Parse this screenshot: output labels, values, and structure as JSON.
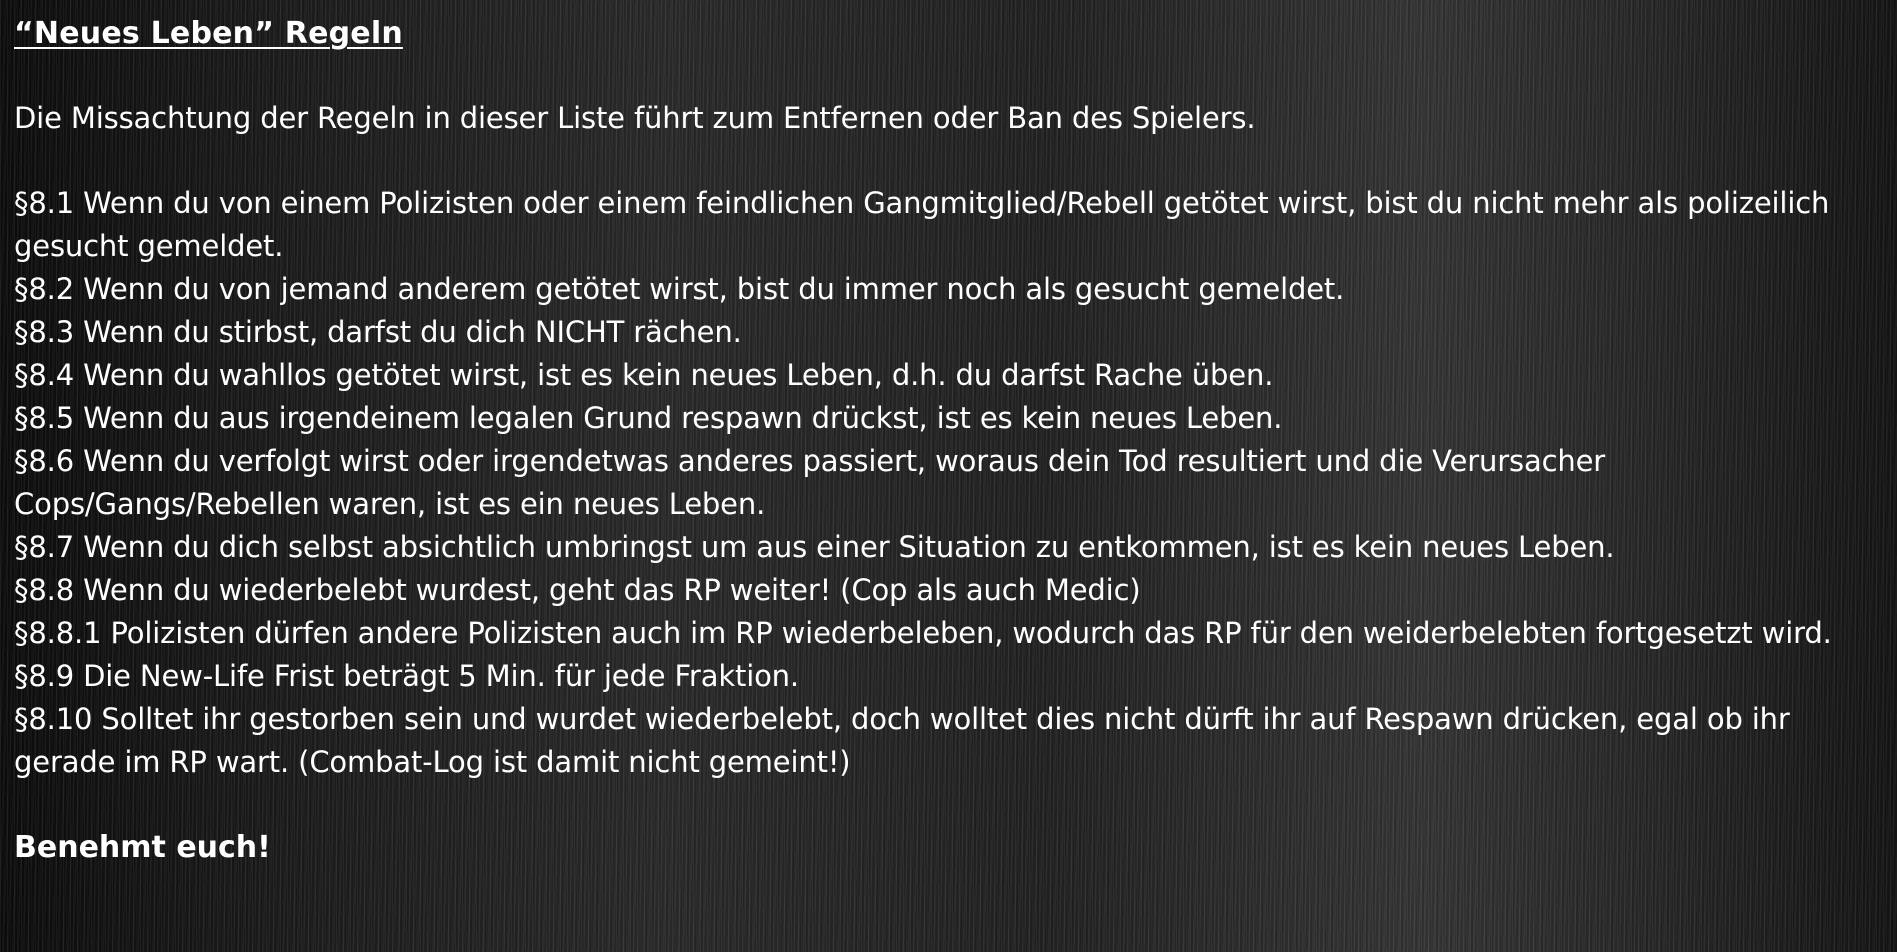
{
  "document": {
    "title": "“Neues Leben” Regeln",
    "intro": "Die Missachtung der Regeln in dieser Liste führt zum Entfernen oder Ban des Spielers.",
    "rules": [
      "§8.1 Wenn du von einem Polizisten oder einem feindlichen Gangmitglied/Rebell getötet wirst, bist du nicht mehr als polizeilich gesucht gemeldet.",
      "§8.2 Wenn du von jemand anderem getötet wirst, bist du immer noch als gesucht gemeldet.",
      "§8.3 Wenn du stirbst, darfst du dich NICHT rächen.",
      "§8.4 Wenn du wahllos getötet wirst, ist es kein neues Leben, d.h. du darfst Rache üben.",
      "§8.5 Wenn du aus irgendeinem legalen Grund respawn drückst, ist es kein neues Leben.",
      "§8.6 Wenn du verfolgt wirst oder irgendetwas anderes passiert, woraus dein Tod resultiert und die Verursacher Cops/Gangs/Rebellen waren, ist es ein neues Leben.",
      "§8.7 Wenn du dich selbst absichtlich umbringst um aus einer Situation zu entkommen, ist es kein neues Leben.",
      "§8.8 Wenn du wiederbelebt wurdest, geht das RP weiter! (Cop als auch Medic)",
      "§8.8.1 Polizisten dürfen andere Polizisten auch im RP wiederbeleben, wodurch das RP für den weiderbelebten fortgesetzt wird.",
      "§8.9 Die New-Life Frist beträgt 5 Min. für jede Fraktion.",
      "§8.10 Solltet ihr gestorben sein und wurdet wiederbelebt, doch wolltet dies nicht dürft ihr auf Respawn drücken, egal ob ihr gerade im RP wart. (Combat-Log ist damit nicht gemeint!)"
    ],
    "closing": "Benehmt euch!"
  },
  "colors": {
    "text": "#ffffff",
    "background": "#1a1a1a"
  }
}
